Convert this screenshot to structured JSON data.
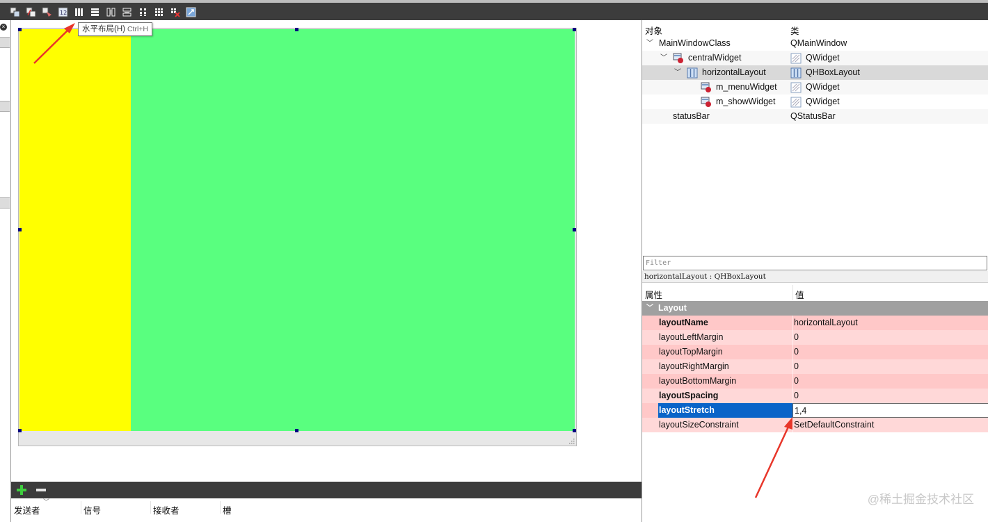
{
  "toolbar": {
    "icons": [
      "edit-widgets-icon",
      "edit-signals-icon",
      "edit-buddies-icon",
      "edit-tab-order-icon",
      "horizontal-layout-icon",
      "vertical-layout-icon",
      "horizontal-splitter-icon",
      "vertical-splitter-icon",
      "form-layout-icon",
      "grid-layout-icon",
      "break-layout-icon",
      "adjust-size-icon"
    ],
    "tooltip": {
      "label": "水平布局(H)",
      "shortcut": "Ctrl+H"
    }
  },
  "form": {
    "menu_widget_color": "#ffff00",
    "show_widget_color": "#59ff7f",
    "stretch": [
      1,
      4
    ]
  },
  "signal_slot": {
    "columns": [
      "发送者",
      "信号",
      "接收者",
      "槽"
    ]
  },
  "object_inspector": {
    "header": {
      "object": "对象",
      "class": "类"
    },
    "rows": [
      {
        "name": "MainWindowClass",
        "class": "QMainWindow"
      },
      {
        "name": "centralWidget",
        "class": "QWidget"
      },
      {
        "name": "horizontalLayout",
        "class": "QHBoxLayout"
      },
      {
        "name": "m_menuWidget",
        "class": "QWidget"
      },
      {
        "name": "m_showWidget",
        "class": "QWidget"
      },
      {
        "name": "statusBar",
        "class": "QStatusBar"
      }
    ]
  },
  "property_editor": {
    "filter_placeholder": "Filter",
    "title": "horizontalLayout : QHBoxLayout",
    "header": {
      "property": "属性",
      "value": "值"
    },
    "group": "Layout",
    "rows": [
      {
        "name": "layoutName",
        "value": "horizontalLayout"
      },
      {
        "name": "layoutLeftMargin",
        "value": "0"
      },
      {
        "name": "layoutTopMargin",
        "value": "0"
      },
      {
        "name": "layoutRightMargin",
        "value": "0"
      },
      {
        "name": "layoutBottomMargin",
        "value": "0"
      },
      {
        "name": "layoutSpacing",
        "value": "0"
      },
      {
        "name": "layoutStretch",
        "value": "1,4"
      },
      {
        "name": "layoutSizeConstraint",
        "value": "SetDefaultConstraint"
      }
    ]
  },
  "annotations": {
    "arrow_color": "#e8362a"
  },
  "watermark": "@稀土掘金技术社区"
}
